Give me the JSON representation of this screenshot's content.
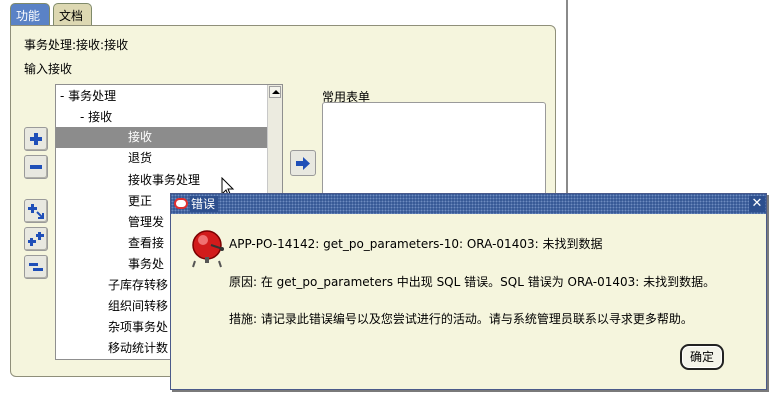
{
  "tabs": [
    {
      "label": "功能",
      "active": true
    },
    {
      "label": "文档",
      "active": false
    }
  ],
  "navigator": {
    "path": "事务处理:接收:接收",
    "input_label": "输入接收",
    "favorites_label": "常用表单",
    "tree": [
      {
        "label": "-  事务处理",
        "indent": 0,
        "selected": false
      },
      {
        "label": "-  接收",
        "indent": 1,
        "selected": false
      },
      {
        "label": "接收",
        "indent": 3,
        "selected": true
      },
      {
        "label": "退货",
        "indent": 3,
        "selected": false
      },
      {
        "label": "接收事务处理",
        "indent": 3,
        "selected": false
      },
      {
        "label": "更正",
        "indent": 3,
        "selected": false
      },
      {
        "label": "管理发",
        "indent": 3,
        "selected": false
      },
      {
        "label": "查看接",
        "indent": 3,
        "selected": false
      },
      {
        "label": "事务处",
        "indent": 3,
        "selected": false
      },
      {
        "label": "子库存转移",
        "indent": 2,
        "selected": false
      },
      {
        "label": "组织间转移",
        "indent": 2,
        "selected": false
      },
      {
        "label": "杂项事务处",
        "indent": 2,
        "selected": false
      },
      {
        "label": "移动统计数",
        "indent": 2,
        "selected": false
      }
    ],
    "side_buttons": [
      "expand-one",
      "collapse-one",
      "expand-branch",
      "expand-all",
      "collapse-all"
    ]
  },
  "dialog": {
    "title": "错误",
    "close_glyph": "✕",
    "messages": [
      "APP-PO-14142: get_po_parameters-10: ORA-01403: 未找到数据",
      "原因: 在 get_po_parameters 中出现 SQL 错误。SQL 错误为 ORA-01403: 未找到数据。",
      "措施: 请记录此错误编号以及您尝试进行的活动。请与系统管理员联系以寻求更多帮助。"
    ],
    "ok_label": "确定"
  },
  "colors": {
    "panel_bg": "#f5f5dd",
    "active_tab": "#5a82c6",
    "titlebar": "#2d4f8e",
    "selection": "#8c8c8c",
    "button_blue": "#1f4fb8"
  }
}
